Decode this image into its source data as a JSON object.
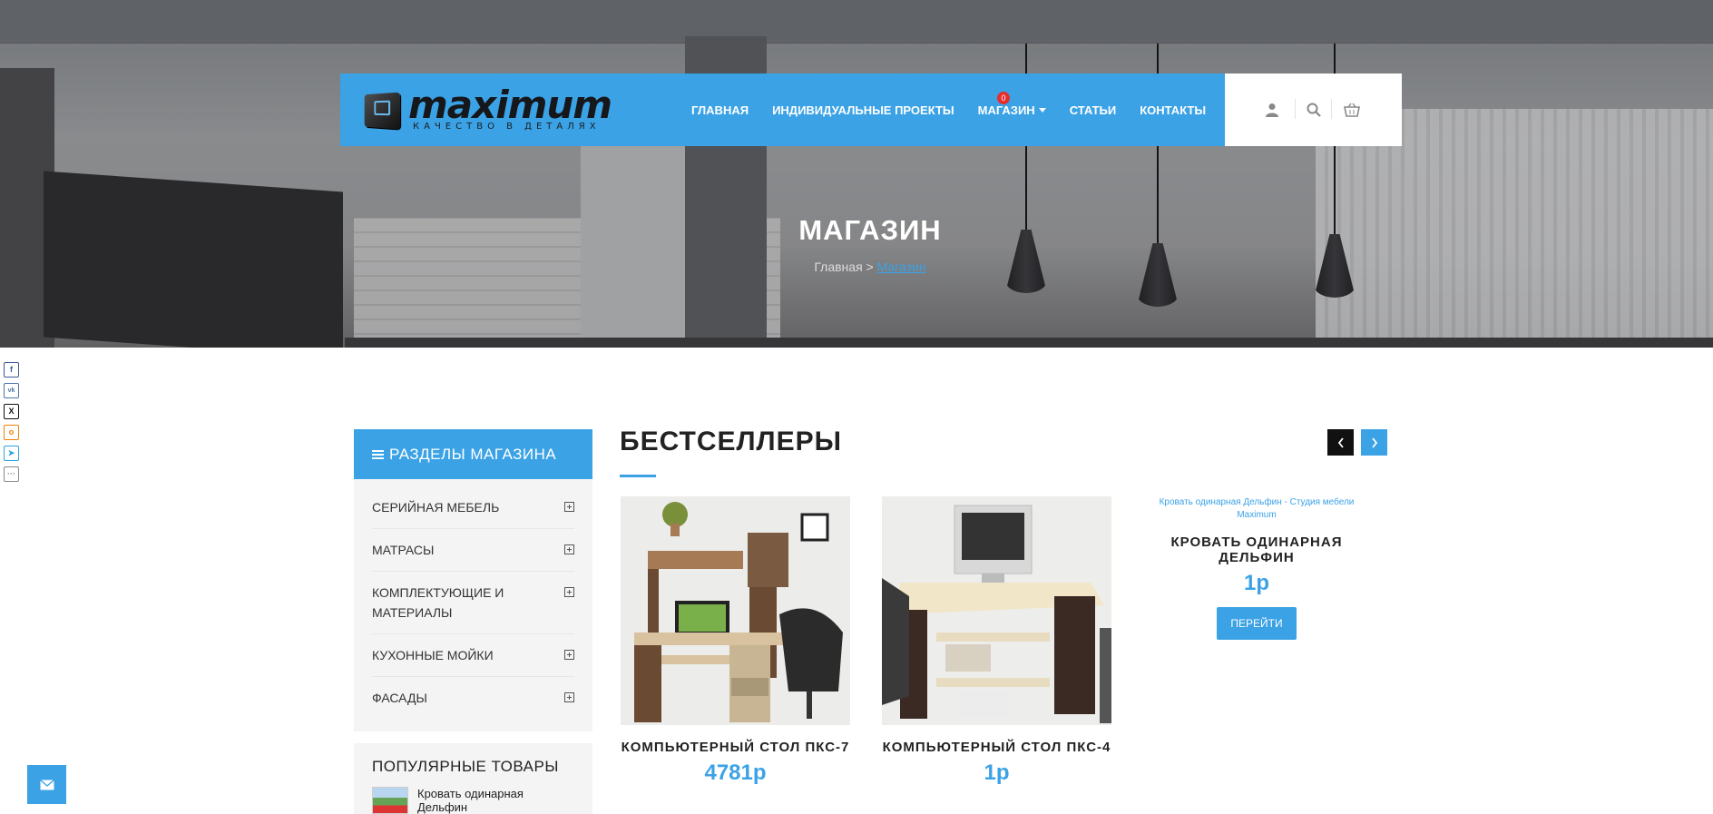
{
  "header": {
    "logo_text": "maximum",
    "logo_tagline": "КАЧЕСТВО В ДЕТАЛЯХ",
    "menu": [
      {
        "label": "ГЛАВНАЯ"
      },
      {
        "label": "ИНДИВИДУАЛЬНЫЕ ПРОЕКТЫ"
      },
      {
        "label": "МАГАЗИН"
      },
      {
        "label": "СТАТЬИ"
      },
      {
        "label": "КОНТАКТЫ"
      }
    ],
    "cart_count": "0",
    "icons": [
      "user-icon",
      "search-icon",
      "cart-icon"
    ]
  },
  "hero": {
    "title": "МАГАЗИН",
    "breadcrumb_home": "Главная",
    "breadcrumb_sep": " > ",
    "breadcrumb_current": "Магазин"
  },
  "social": [
    "facebook",
    "vk",
    "x",
    "odnoklassniki",
    "telegram",
    "more"
  ],
  "sidebar": {
    "title": "РАЗДЕЛЫ МАГАЗИНА",
    "items": [
      {
        "label": "СЕРИЙНАЯ МЕБЕЛЬ"
      },
      {
        "label": "МАТРАСЫ"
      },
      {
        "label": "КОМПЛЕКТУЮЩИЕ И МАТЕРИАЛЫ"
      },
      {
        "label": "КУХОННЫЕ МОЙКИ"
      },
      {
        "label": "ФАСАДЫ"
      }
    ],
    "popular_title": "ПОПУЛЯРНЫЕ ТОВАРЫ",
    "popular_items": [
      {
        "name": "Кровать одинарная Дельфин"
      }
    ]
  },
  "main": {
    "section_title": "БЕСТСЕЛЛЕРЫ",
    "products": [
      {
        "name": "КОМПЬЮТЕРНЫЙ СТОЛ ПКС-7",
        "price": "4781р"
      },
      {
        "name": "КОМПЬЮТЕРНЫЙ СТОЛ ПКС-4",
        "price": "1р"
      },
      {
        "alt": "Кровать одинарная Дельфин - Студия мебели Maximum",
        "name": "КРОВАТЬ ОДИНАРНАЯ ДЕЛЬФИН",
        "price": "1р",
        "button": "ПЕРЕЙТИ"
      }
    ]
  },
  "colors": {
    "accent": "#3ba2e6",
    "dark": "#111111",
    "badge": "#e52e2e"
  }
}
